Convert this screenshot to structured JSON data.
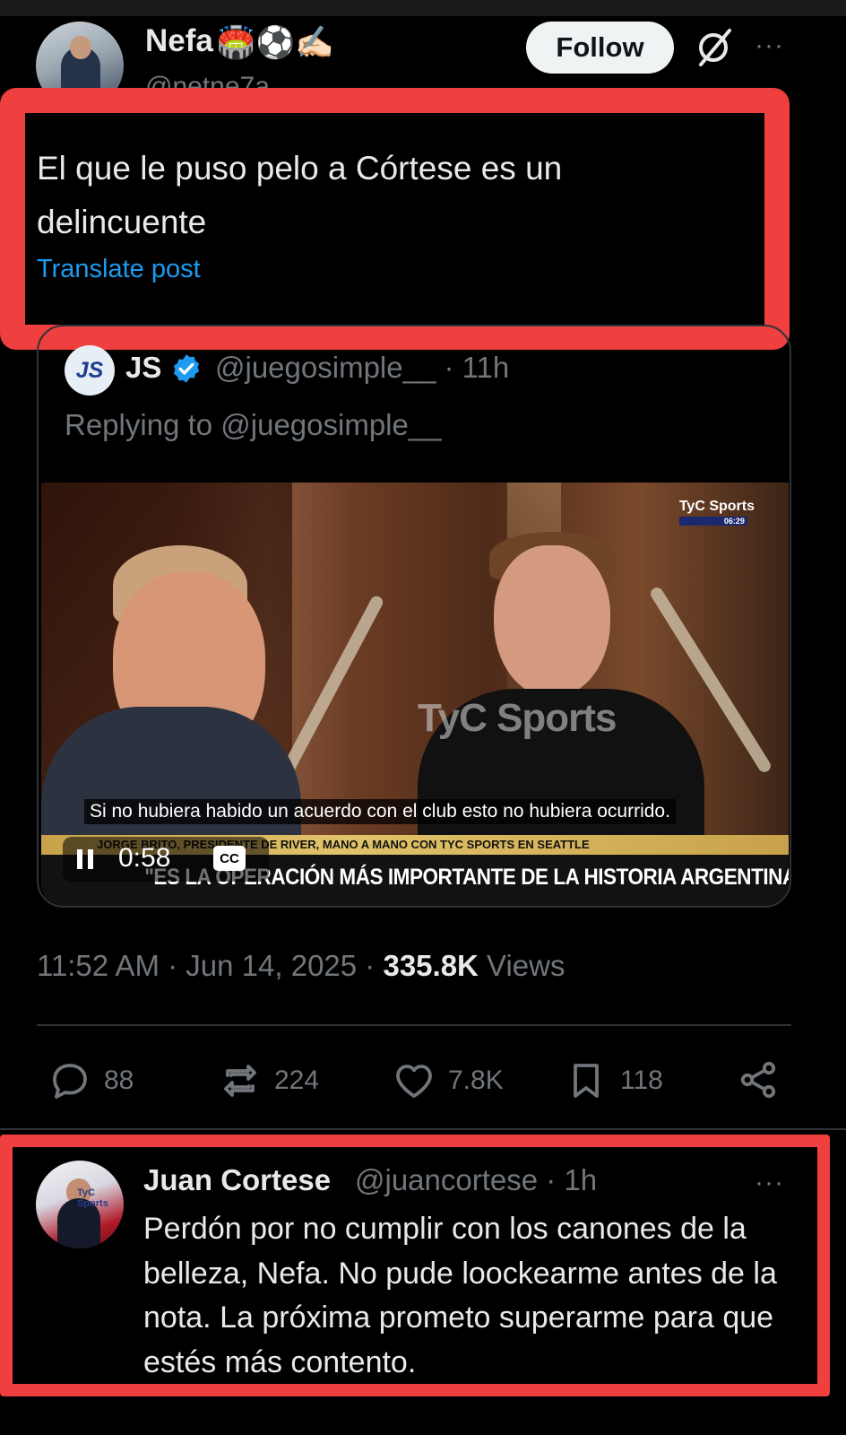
{
  "post": {
    "author_name": "Nefa",
    "author_emojis": "🏟️⚽✍🏻",
    "author_handle": "@netne7a",
    "follow_label": "Follow",
    "more": "···",
    "text": "El que le puso pelo a Córtese es un delincuente",
    "translate_label": "Translate post",
    "timestamp": "11:52 AM · Jun 14, 2025 · ",
    "views_count": "335.8K",
    "views_label": " Views"
  },
  "quoted": {
    "logo": "JS",
    "name": "JS",
    "handle_time": "@juegosimple__ · 11h",
    "replying": "Replying to @juegosimple__",
    "video": {
      "watermark": "TyC Sports",
      "channel_logo": "TyC Sports",
      "channel_clock": "06:29",
      "subtitle": "Si no hubiera habido un acuerdo con el club esto no hubiera ocurrido.",
      "lower_top": "JORGE BRITO, PRESIDENTE DE RIVER, MANO A MANO CON TYC SPORTS EN SEATTLE",
      "lower_main": "\"ES LA OPERACIÓN MÁS IMPORTANTE DE LA HISTORIA ARGENTINA\"",
      "time": "0:58",
      "cc": "CC"
    }
  },
  "actions": {
    "replies": "88",
    "reposts": "224",
    "likes": "7.8K",
    "bookmarks": "118"
  },
  "reply": {
    "name": "Juan Cortese",
    "handle_time": "@juancortese · 1h",
    "more": "···",
    "text": "Perdón por no cumplir con los canones de la belleza, Nefa. No pude loockearme antes de la nota. La próxima prometo superarme para que estés más contento.",
    "avatar_tag": "TyC Sports"
  },
  "colors": {
    "highlight": "#ef3f3f",
    "link": "#1d9bf0",
    "muted": "#71767b",
    "verified": "#1d9bf0"
  }
}
